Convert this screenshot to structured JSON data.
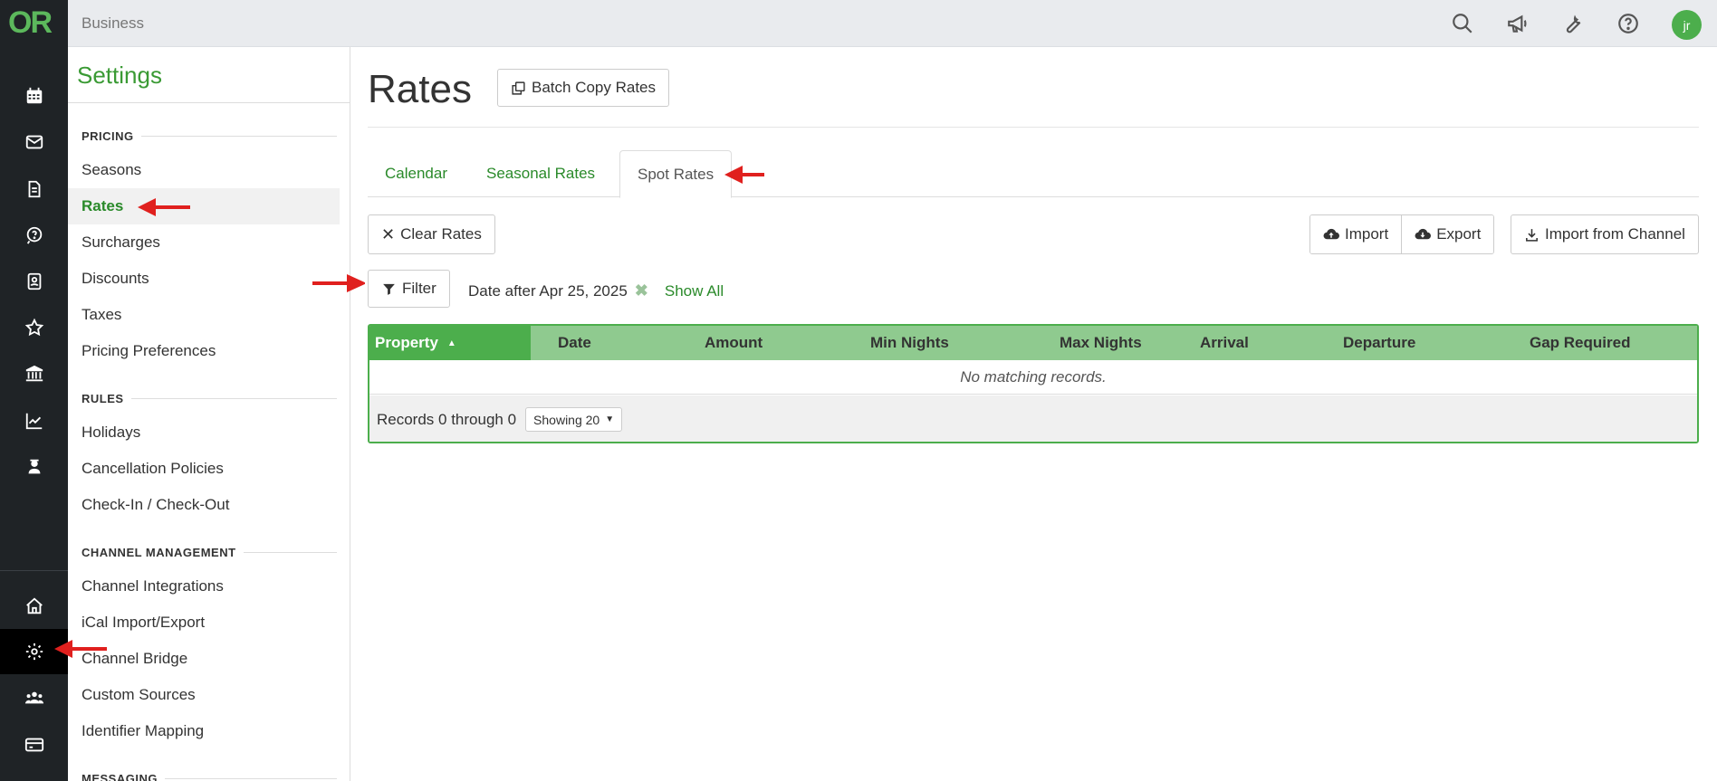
{
  "app": {
    "logo": "OR",
    "breadcrumb": "Business"
  },
  "topbar": {
    "icons": [
      "search-icon",
      "megaphone-icon",
      "wrench-icon",
      "help-icon"
    ],
    "avatar_initials": "jr"
  },
  "rail": {
    "icons": [
      "calendar-icon",
      "envelope-icon",
      "document-icon",
      "chat-icon",
      "contacts-icon",
      "star-icon",
      "bank-icon",
      "chart-icon",
      "user-badge-icon",
      "home-icon",
      "gear-icon",
      "users-icon",
      "credit-card-icon"
    ],
    "active": "gear-icon"
  },
  "sidebar": {
    "title": "Settings",
    "sections": {
      "pricing": "PRICING",
      "rules": "RULES",
      "channel": "CHANNEL MANAGEMENT",
      "messaging": "MESSAGING"
    },
    "items": {
      "seasons": "Seasons",
      "rates": "Rates",
      "surcharges": "Surcharges",
      "discounts": "Discounts",
      "taxes": "Taxes",
      "pricing_preferences": "Pricing Preferences",
      "holidays": "Holidays",
      "cancellation": "Cancellation Policies",
      "checkin": "Check-In / Check-Out",
      "channel_integrations": "Channel Integrations",
      "ical": "iCal Import/Export",
      "channel_bridge": "Channel Bridge",
      "custom_sources": "Custom Sources",
      "identifier_mapping": "Identifier Mapping"
    }
  },
  "main": {
    "title": "Rates",
    "batch_copy": "Batch Copy Rates",
    "tabs": {
      "calendar": "Calendar",
      "seasonal": "Seasonal Rates",
      "spot": "Spot Rates"
    },
    "clear_rates": "Clear Rates",
    "import": "Import",
    "export": "Export",
    "import_channel": "Import from Channel",
    "filter": "Filter",
    "filter_text": "Date after Apr 25, 2025",
    "show_all": "Show All"
  },
  "table": {
    "columns": [
      "Property",
      "Date",
      "Amount",
      "Min Nights",
      "Max Nights",
      "Arrival",
      "Departure",
      "Gap Required"
    ],
    "empty": "No matching records.",
    "records": "Records 0 through 0",
    "showing": "Showing 20"
  },
  "colors": {
    "brand_green": "#4cae4c",
    "header_green": "#8fca8f",
    "link_green": "#2a8a2a",
    "rail_bg": "#1f2326",
    "annotation_red": "#e0201e"
  }
}
